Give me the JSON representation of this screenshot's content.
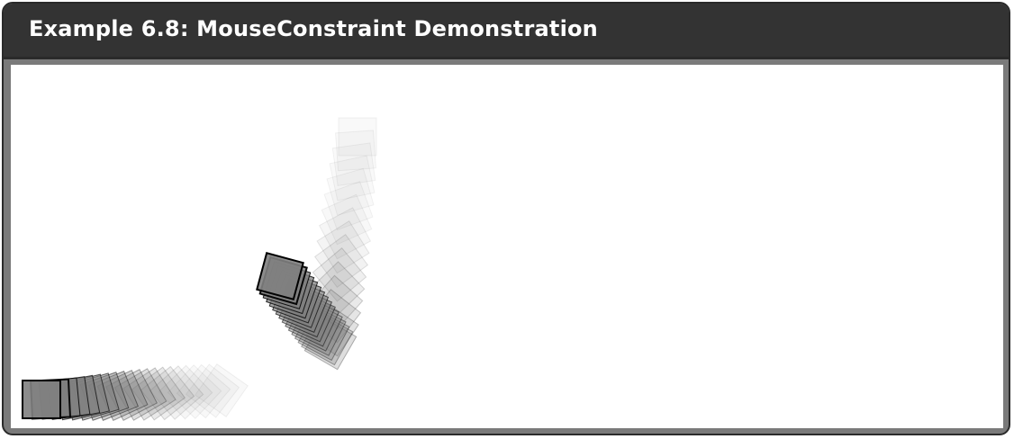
{
  "window": {
    "title": "Example 6.8: MouseConstraint Demonstration"
  },
  "colors": {
    "titlebar": "#333333",
    "frame": "#7a7a7a",
    "canvas": "#ffffff",
    "box_fill": "#7f7f7f",
    "box_stroke": "#000000"
  }
}
